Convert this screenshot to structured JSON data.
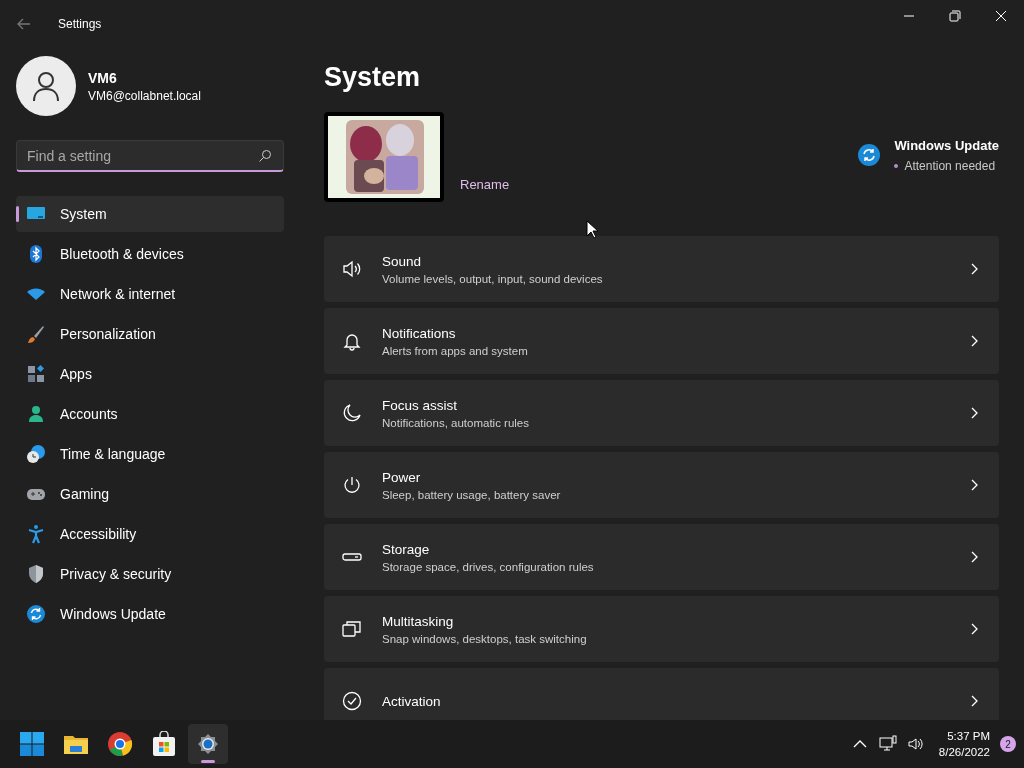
{
  "window": {
    "title": "Settings"
  },
  "user": {
    "name": "VM6",
    "email": "VM6@collabnet.local"
  },
  "search": {
    "placeholder": "Find a setting"
  },
  "sidebar": {
    "items": [
      {
        "label": "System",
        "kind": "system",
        "selected": true
      },
      {
        "label": "Bluetooth & devices",
        "kind": "bluetooth",
        "selected": false
      },
      {
        "label": "Network & internet",
        "kind": "wifi",
        "selected": false
      },
      {
        "label": "Personalization",
        "kind": "brush",
        "selected": false
      },
      {
        "label": "Apps",
        "kind": "apps",
        "selected": false
      },
      {
        "label": "Accounts",
        "kind": "person",
        "selected": false
      },
      {
        "label": "Time & language",
        "kind": "clock",
        "selected": false
      },
      {
        "label": "Gaming",
        "kind": "gamepad",
        "selected": false
      },
      {
        "label": "Accessibility",
        "kind": "accessibility",
        "selected": false
      },
      {
        "label": "Privacy & security",
        "kind": "shield",
        "selected": false
      },
      {
        "label": "Windows Update",
        "kind": "update",
        "selected": false
      }
    ]
  },
  "page": {
    "title": "System"
  },
  "device": {
    "rename": "Rename"
  },
  "update_status": {
    "title": "Windows Update",
    "status": "Attention needed"
  },
  "cards": [
    {
      "kind": "speaker",
      "title": "Sound",
      "description": "Volume levels, output, input, sound devices"
    },
    {
      "kind": "bell",
      "title": "Notifications",
      "description": "Alerts from apps and system"
    },
    {
      "kind": "moon",
      "title": "Focus assist",
      "description": "Notifications, automatic rules"
    },
    {
      "kind": "power",
      "title": "Power",
      "description": "Sleep, battery usage, battery saver"
    },
    {
      "kind": "storage",
      "title": "Storage",
      "description": "Storage space, drives, configuration rules"
    },
    {
      "kind": "multitask",
      "title": "Multitasking",
      "description": "Snap windows, desktops, task switching"
    },
    {
      "kind": "check",
      "title": "Activation"
    }
  ],
  "taskbar": {
    "apps": [
      {
        "kind": "start",
        "selected": false
      },
      {
        "kind": "folder",
        "selected": false
      },
      {
        "kind": "browser",
        "selected": false
      },
      {
        "kind": "store",
        "selected": false
      },
      {
        "kind": "gear",
        "selected": true
      }
    ],
    "time": "5:37 PM",
    "date": "8/26/2022",
    "notification_count": "2"
  }
}
